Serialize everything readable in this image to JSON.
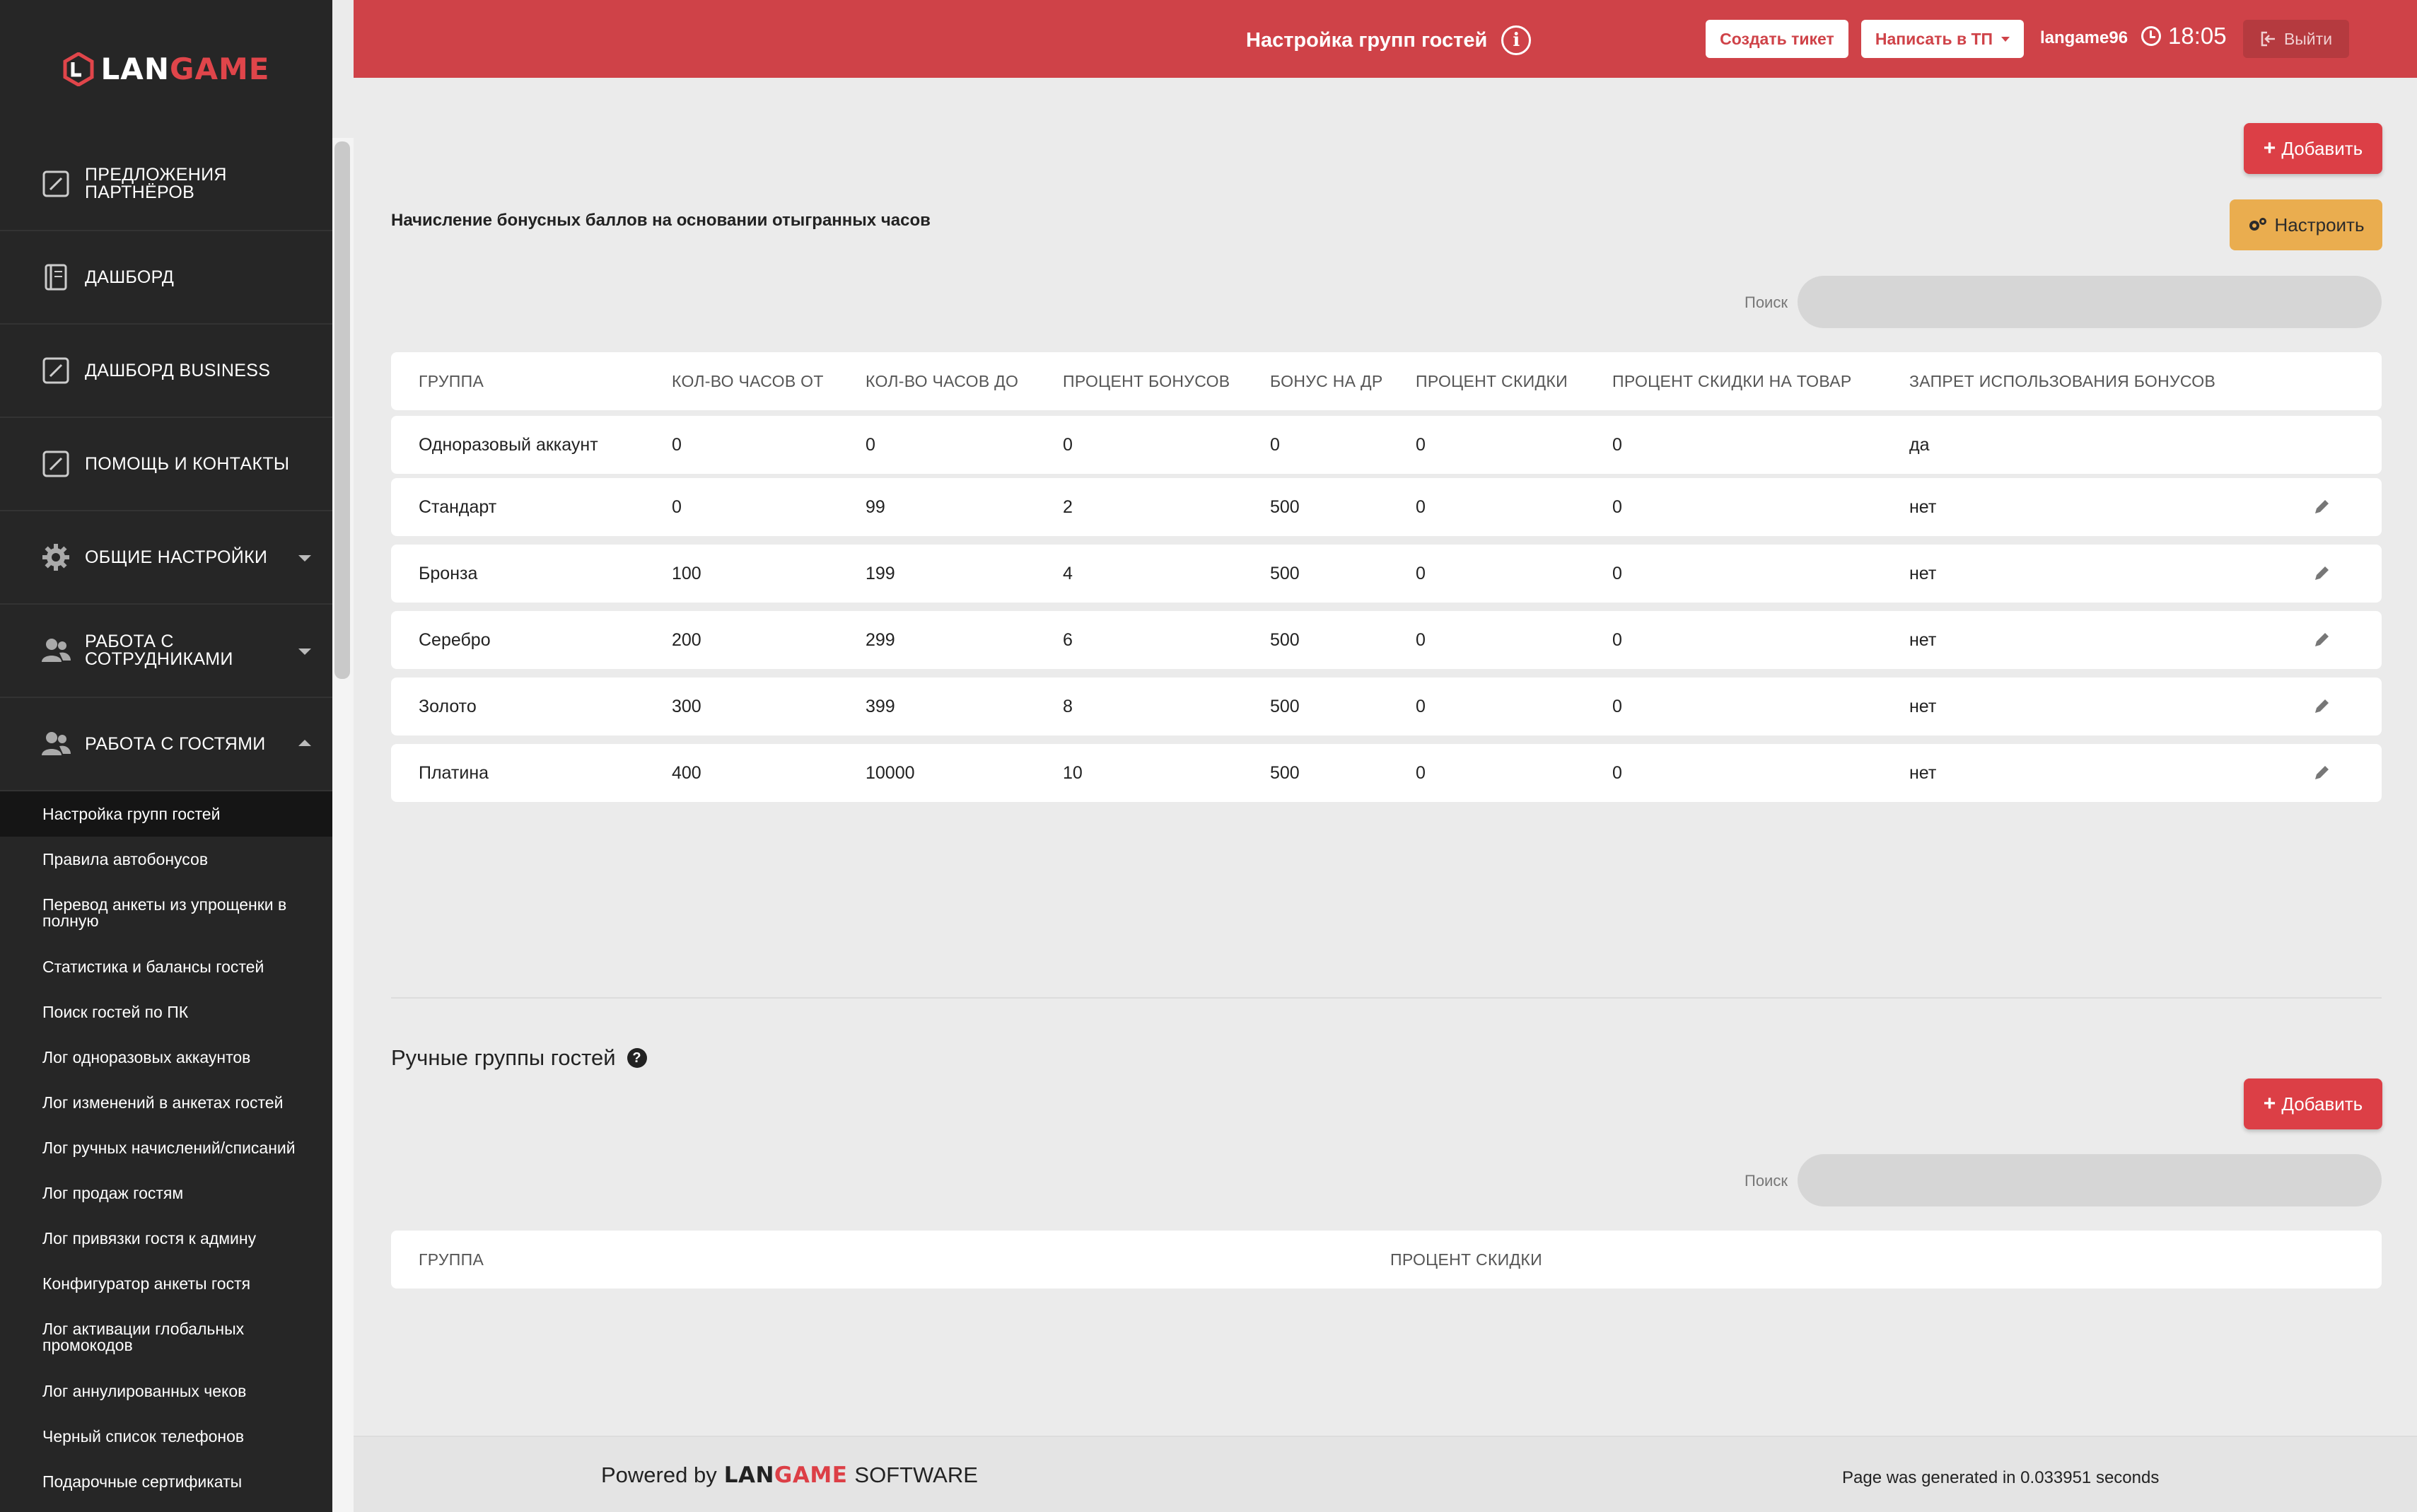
{
  "brand": {
    "lan": "LAN",
    "game": "GAME"
  },
  "sidebar": {
    "items": [
      {
        "label": "Предложения партнёров",
        "icon": "edit-square-icon"
      },
      {
        "label": "Дашборд",
        "icon": "notebook-icon"
      },
      {
        "label": "Дашборд business",
        "icon": "edit-square-icon"
      },
      {
        "label": "Помощь и контакты",
        "icon": "edit-square-icon"
      },
      {
        "label": "Общие настройки",
        "icon": "gear-icon"
      },
      {
        "label": "Работа с сотрудниками",
        "icon": "users-icon"
      },
      {
        "label": "Работа с гостями",
        "icon": "users-icon"
      }
    ],
    "subitems": [
      "Настройка групп гостей",
      "Правила автобонусов",
      "Перевод анкеты из упрощенки в полную",
      "Статистика и балансы гостей",
      "Поиск гостей по ПК",
      "Лог одноразовых аккаунтов",
      "Лог изменений в анкетах гостей",
      "Лог ручных начислений/списаний",
      "Лог продаж гостям",
      "Лог привязки гостя к админу",
      "Конфигуратор анкеты гостя",
      "Лог активации глобальных промокодов",
      "Лог аннулированных чеков",
      "Черный список телефонов",
      "Подарочные сертификаты"
    ]
  },
  "header": {
    "title": "Настройка групп гостей",
    "create_ticket": "Создать тикет",
    "write_tp": "Написать в ТП",
    "user": "langame96",
    "time": "18:05",
    "logout": "Выйти",
    "accent": "#cf4248"
  },
  "auto_groups": {
    "add_label": "Добавить",
    "configure_label": "Настроить",
    "title": "Начисление бонусных баллов на основании отыгранных часов",
    "search_label": "Поиск",
    "columns": [
      "Группа",
      "Кол-во часов от",
      "Кол-во часов до",
      "Процент бонусов",
      "Бонус на ДР",
      "Процент скидки",
      "Процент скидки на товар",
      "Запрет использования бонусов"
    ],
    "rows": [
      [
        "Одноразовый аккаунт",
        "0",
        "0",
        "0",
        "0",
        "0",
        "0",
        "да"
      ],
      [
        "Стандарт",
        "0",
        "99",
        "2",
        "500",
        "0",
        "0",
        "нет"
      ],
      [
        "Бронза",
        "100",
        "199",
        "4",
        "500",
        "0",
        "0",
        "нет"
      ],
      [
        "Серебро",
        "200",
        "299",
        "6",
        "500",
        "0",
        "0",
        "нет"
      ],
      [
        "Золото",
        "300",
        "399",
        "8",
        "500",
        "0",
        "0",
        "нет"
      ],
      [
        "Платина",
        "400",
        "10000",
        "10",
        "500",
        "0",
        "0",
        "нет"
      ]
    ]
  },
  "manual_groups": {
    "title": "Ручные группы гостей",
    "add_label": "Добавить",
    "search_label": "Поиск",
    "columns": [
      "Группа",
      "Процент скидки"
    ]
  },
  "footer": {
    "powered_by": "Powered by",
    "brand_lan": "LAN",
    "brand_game": "GAME",
    "software": "SOFTWARE",
    "generated": "Page was generated in 0.033951 seconds"
  }
}
